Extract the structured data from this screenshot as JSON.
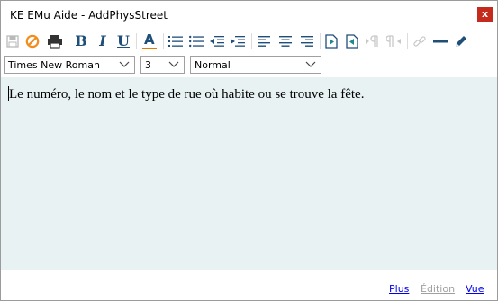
{
  "window": {
    "title": "KE EMu Aide - AddPhysStreet",
    "close_label": "x"
  },
  "toolbar": {
    "bold_label": "B",
    "italic_label": "I",
    "underline_label": "U",
    "font_color_label": "A",
    "icons": [
      "save-icon",
      "cancel-icon",
      "print-icon",
      "bold-icon",
      "italic-icon",
      "underline-icon",
      "font-color-icon",
      "numbered-list-icon",
      "bullet-list-icon",
      "decrease-indent-icon",
      "increase-indent-icon",
      "align-left-icon",
      "align-center-icon",
      "align-right-icon",
      "insert-before-icon",
      "insert-after-icon",
      "ltr-paragraph-icon",
      "rtl-paragraph-icon",
      "link-icon",
      "horizontal-rule-icon",
      "pen-icon"
    ]
  },
  "format": {
    "font_family": "Times New Roman",
    "font_size": "3",
    "paragraph_style": "Normal"
  },
  "editor": {
    "content": "Le numéro, le nom et le type de rue où habite ou se trouve la fête."
  },
  "footer": {
    "more_label": "Plus",
    "edit_label": "Édition",
    "view_label": "Vue"
  },
  "colors": {
    "editor_bg": "#e8f2f2",
    "close_bg": "#c42b1c",
    "icon_blue": "#1f4e79",
    "font_color_underline": "#e07b00",
    "cancel_orange": "#f28c1b",
    "link": "#0000ee"
  }
}
